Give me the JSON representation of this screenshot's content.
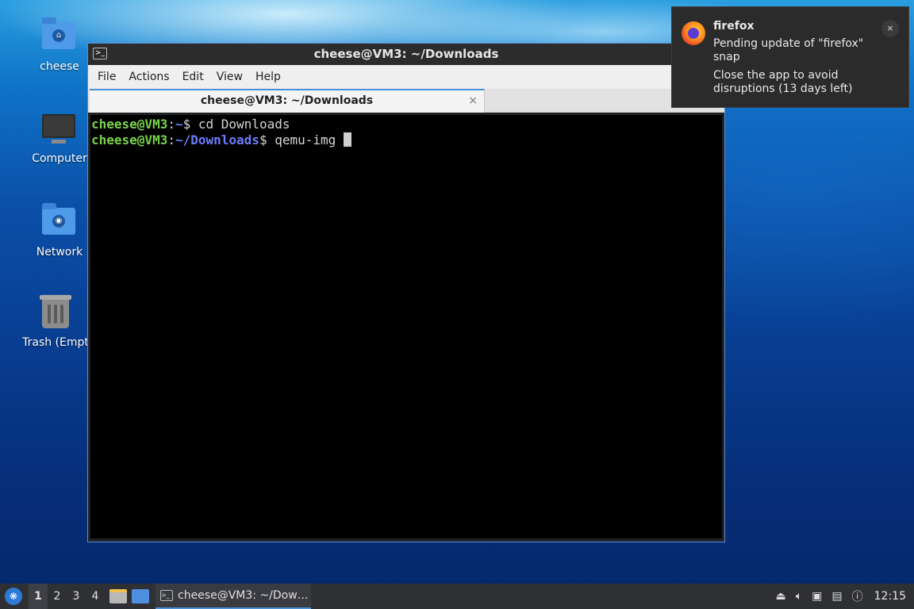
{
  "desktop": {
    "icons": [
      {
        "label": "cheese",
        "icon": "home-folder-icon"
      },
      {
        "label": "Computer",
        "icon": "computer-icon"
      },
      {
        "label": "Network",
        "icon": "network-folder-icon"
      },
      {
        "label": "Trash (Empt",
        "icon": "trash-icon"
      }
    ]
  },
  "window": {
    "title": "cheese@VM3: ~/Downloads",
    "menu": [
      "File",
      "Actions",
      "Edit",
      "View",
      "Help"
    ],
    "tab": {
      "label": "cheese@VM3: ~/Downloads",
      "close": "×"
    },
    "terminal": {
      "lines": [
        {
          "user": "cheese@VM3",
          "sep": ":",
          "path": "~",
          "prompt": "$ ",
          "cmd": "cd Downloads"
        },
        {
          "user": "cheese@VM3",
          "sep": ":",
          "path": "~/Downloads",
          "prompt": "$ ",
          "cmd": "qemu-img "
        }
      ]
    }
  },
  "notification": {
    "app": "firefox",
    "line1": "Pending update of \"firefox\" snap",
    "line2": "Close the app to avoid disruptions (13 days left)",
    "close": "×"
  },
  "taskbar": {
    "workspaces": [
      "1",
      "2",
      "3",
      "4"
    ],
    "active_workspace": "1",
    "task_label": "cheese@VM3: ~/Dow…",
    "clock": "12:15"
  },
  "colors": {
    "prompt_user": "#7bd34a",
    "prompt_path": "#6c7dff",
    "accent": "#4a90d9"
  }
}
